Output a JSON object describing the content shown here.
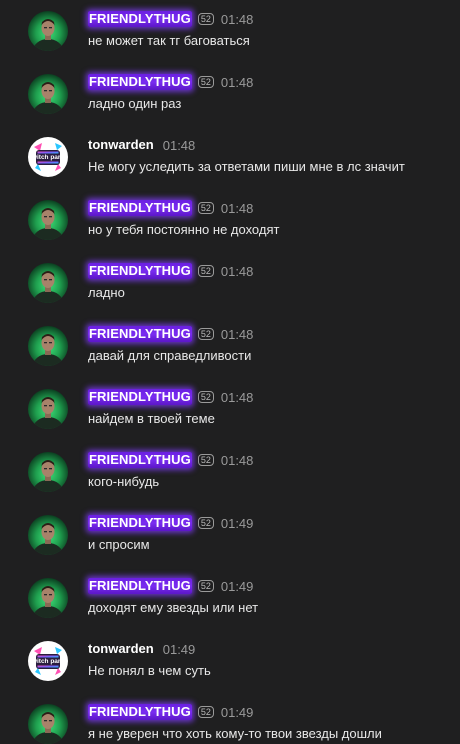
{
  "messages": [
    {
      "author": "FRIENDLYTHUG",
      "kind": "friendly",
      "badge": "52",
      "time": "01:48",
      "text": "не может так тг баговаться"
    },
    {
      "author": "FRIENDLYTHUG",
      "kind": "friendly",
      "badge": "52",
      "time": "01:48",
      "text": "ладно один раз"
    },
    {
      "author": "tonwarden",
      "kind": "ton",
      "badge": "",
      "time": "01:48",
      "text": "Не могу уследить за ответами пиши мне в лс значит"
    },
    {
      "author": "FRIENDLYTHUG",
      "kind": "friendly",
      "badge": "52",
      "time": "01:48",
      "text": "но у тебя постоянно не доходят"
    },
    {
      "author": "FRIENDLYTHUG",
      "kind": "friendly",
      "badge": "52",
      "time": "01:48",
      "text": "ладно"
    },
    {
      "author": "FRIENDLYTHUG",
      "kind": "friendly",
      "badge": "52",
      "time": "01:48",
      "text": "давай для справедливости"
    },
    {
      "author": "FRIENDLYTHUG",
      "kind": "friendly",
      "badge": "52",
      "time": "01:48",
      "text": "найдем в твоей теме"
    },
    {
      "author": "FRIENDLYTHUG",
      "kind": "friendly",
      "badge": "52",
      "time": "01:48",
      "text": "кого-нибудь"
    },
    {
      "author": "FRIENDLYTHUG",
      "kind": "friendly",
      "badge": "52",
      "time": "01:49",
      "text": "и спросим"
    },
    {
      "author": "FRIENDLYTHUG",
      "kind": "friendly",
      "badge": "52",
      "time": "01:49",
      "text": "доходят ему звезды или нет"
    },
    {
      "author": "tonwarden",
      "kind": "ton",
      "badge": "",
      "time": "01:49",
      "text": "Не понял в чем суть"
    },
    {
      "author": "FRIENDLYTHUG",
      "kind": "friendly",
      "badge": "52",
      "time": "01:49",
      "text": "я не уверен что хоть кому-то твои звезды дошли"
    }
  ],
  "avatars": {
    "friendly": {
      "icon": "user-avatar-green-glow",
      "text": ""
    },
    "ton": {
      "icon": "twitch-party-logo",
      "text": "twitch party"
    }
  },
  "colors": {
    "background": "#1f1f20",
    "username_highlight": "#6a1fe0",
    "time": "#9a9a9a",
    "message_text": "#e8e8e8"
  }
}
